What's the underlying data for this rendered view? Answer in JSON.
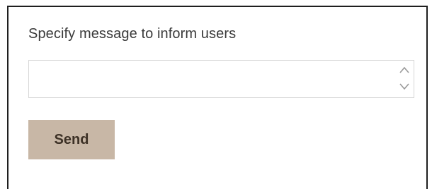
{
  "form": {
    "label": "Specify message to inform users",
    "message": {
      "value": "",
      "placeholder": ""
    },
    "send_label": "Send"
  },
  "colors": {
    "send_button_bg": "#c8b7a6",
    "send_button_text": "#3d3126",
    "label_text": "#3a3a3a",
    "frame_border": "#1f1f1f"
  },
  "icons": {
    "spin_up": "chevron-up-icon",
    "spin_down": "chevron-down-icon"
  }
}
